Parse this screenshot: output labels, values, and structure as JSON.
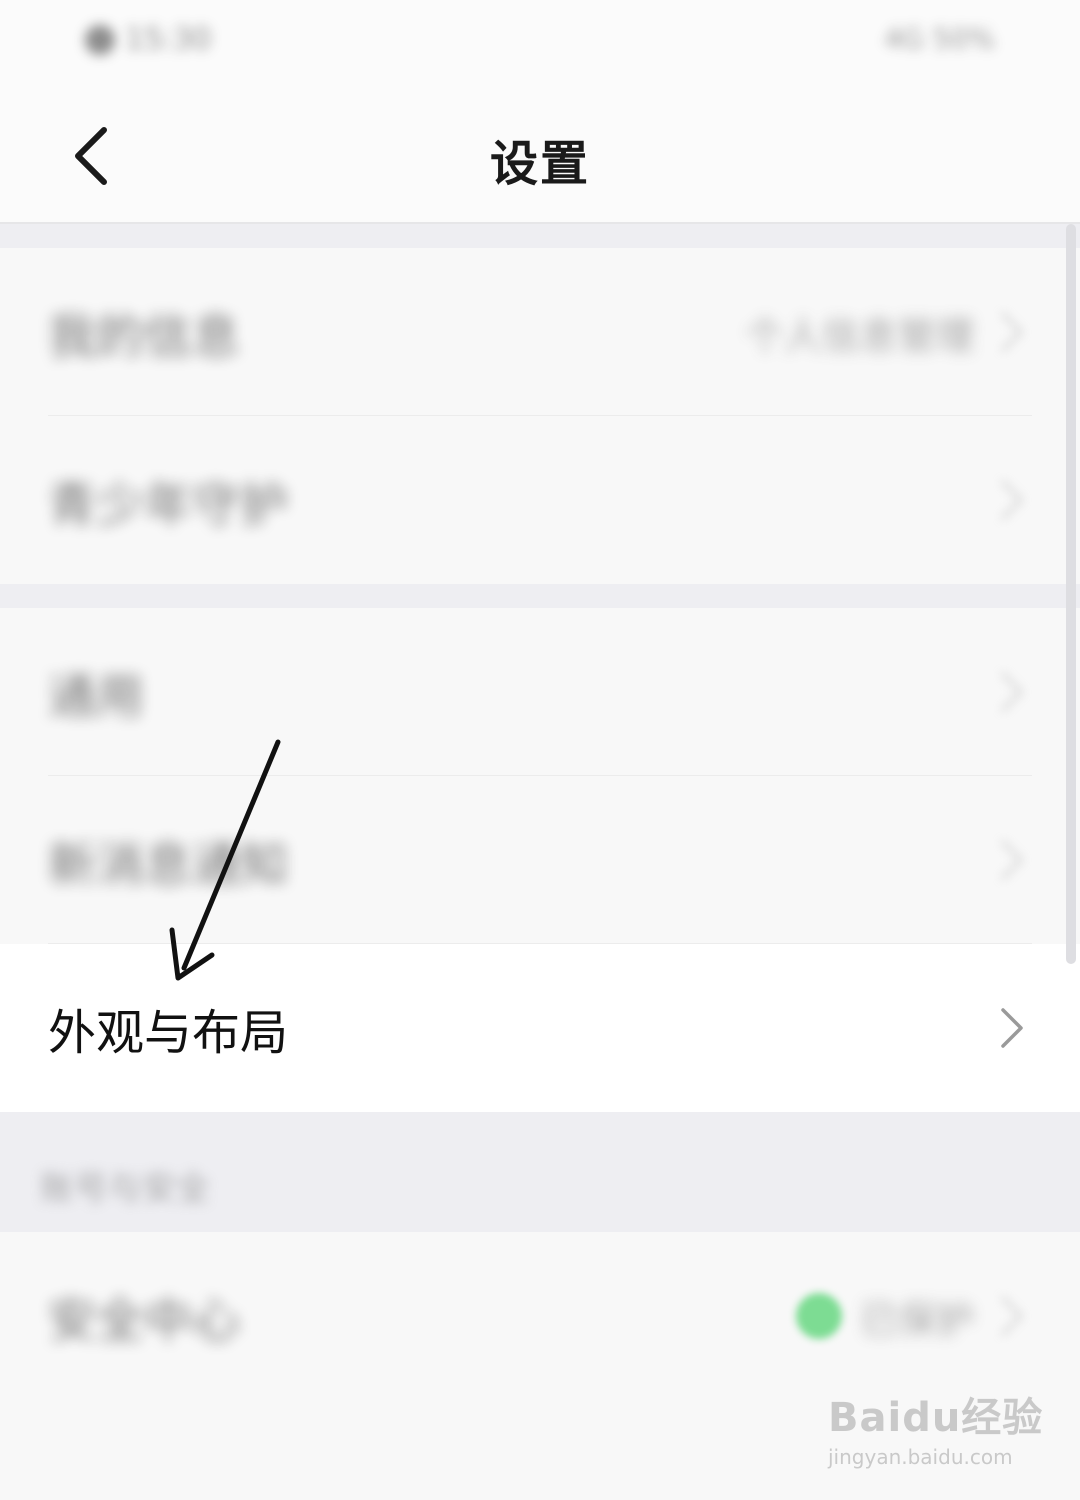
{
  "status_bar": {
    "left_text": "15:30",
    "right_text": "4G 50%"
  },
  "navbar": {
    "title": "设置",
    "back_icon": "chevron-left-icon"
  },
  "groups": [
    {
      "items": [
        {
          "label": "我的信息",
          "value": "个人信息管理",
          "icon": "chevron-right-icon"
        },
        {
          "label": "青少年守护",
          "value": "",
          "icon": "chevron-right-icon"
        }
      ]
    },
    {
      "items": [
        {
          "label": "通用",
          "value": "",
          "icon": "chevron-right-icon"
        },
        {
          "label": "新消息通知",
          "value": "",
          "icon": "chevron-right-icon"
        },
        {
          "label": "外观与布局",
          "value": "",
          "icon": "chevron-right-icon"
        }
      ]
    }
  ],
  "section_header": "账号与安全",
  "security": {
    "label": "安全中心",
    "status": "已保护",
    "status_color": "#7ddc93"
  },
  "annotation": {
    "icon": "arrow-down-left-icon",
    "color": "#111111"
  },
  "watermark": {
    "logo": "Baidu经验",
    "url": "jingyan.baidu.com"
  }
}
